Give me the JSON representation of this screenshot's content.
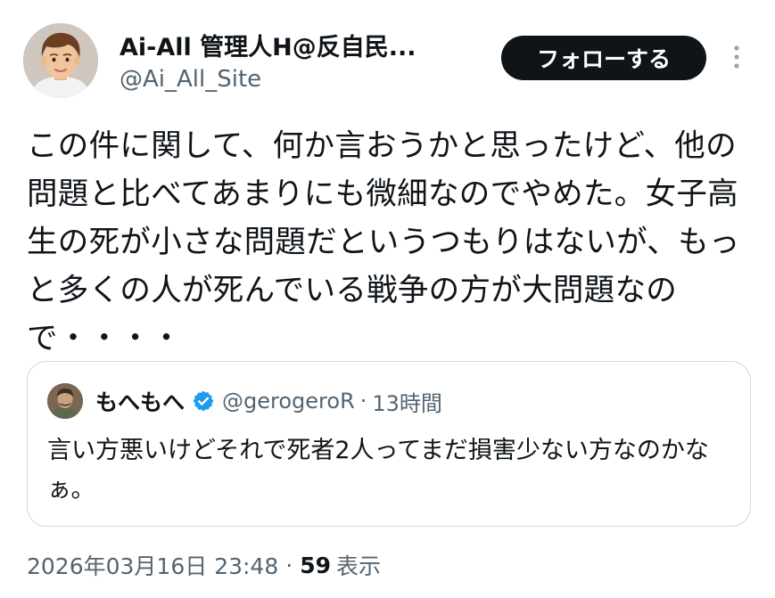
{
  "author": {
    "display_name": "Ai-All 管理人H@反自民...",
    "handle": "@Ai_All_Site",
    "avatar_icon": "cartoon-man-avatar"
  },
  "actions": {
    "follow_label": "フォローする",
    "more_icon": "more-vertical-icon"
  },
  "tweet": {
    "text": "この件に関して、何か言おうかと思ったけど、他の問題と比べてあまりにも微細なのでやめた。女子高生の死が小さな問題だというつもりはないが、もっと多くの人が死んでいる戦争の方が大問題なので・・・・"
  },
  "quoted": {
    "display_name": "もへもへ",
    "verified_icon": "verified-badge-icon",
    "handle": "@gerogeroR",
    "separator": "·",
    "time": "13時間",
    "text": "言い方悪いけどそれで死者2人ってまだ損害少ない方なのかなぁ。"
  },
  "footer": {
    "timestamp": "2026年03月16日 23:48",
    "separator": "·",
    "views_count": "59",
    "views_label": "表示"
  },
  "colors": {
    "text_primary": "#0f1419",
    "text_secondary": "#536471",
    "border": "#cfd9de",
    "follow_bg": "#0f1419",
    "verified": "#1d9bf0"
  }
}
